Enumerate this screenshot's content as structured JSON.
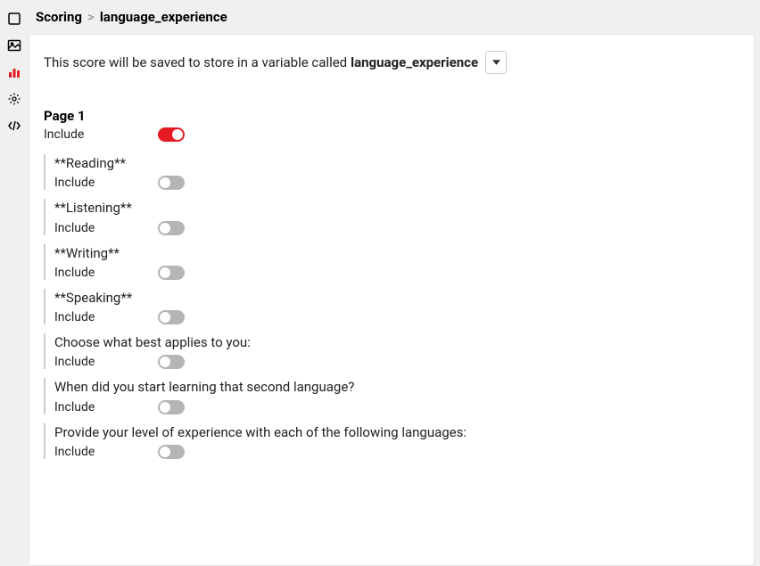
{
  "breadcrumb": {
    "root": "Scoring",
    "sep": ">",
    "leaf": "language_experience"
  },
  "info": {
    "prefix": "This score will be saved to store in a variable called",
    "variable": "language_experience"
  },
  "page": {
    "title": "Page 1",
    "include_label": "Include",
    "include_on": true
  },
  "questions": [
    {
      "title": "**Reading**",
      "include_label": "Include",
      "include_on": false
    },
    {
      "title": "**Listening**",
      "include_label": "Include",
      "include_on": false
    },
    {
      "title": "**Writing**",
      "include_label": "Include",
      "include_on": false
    },
    {
      "title": "**Speaking**",
      "include_label": "Include",
      "include_on": false
    },
    {
      "title": "Choose what best applies to you:",
      "include_label": "Include",
      "include_on": false
    },
    {
      "title": "When did you start learning that second language?",
      "include_label": "Include",
      "include_on": false
    },
    {
      "title": "Provide your level of experience with each of the following languages:",
      "include_label": "Include",
      "include_on": false
    }
  ]
}
